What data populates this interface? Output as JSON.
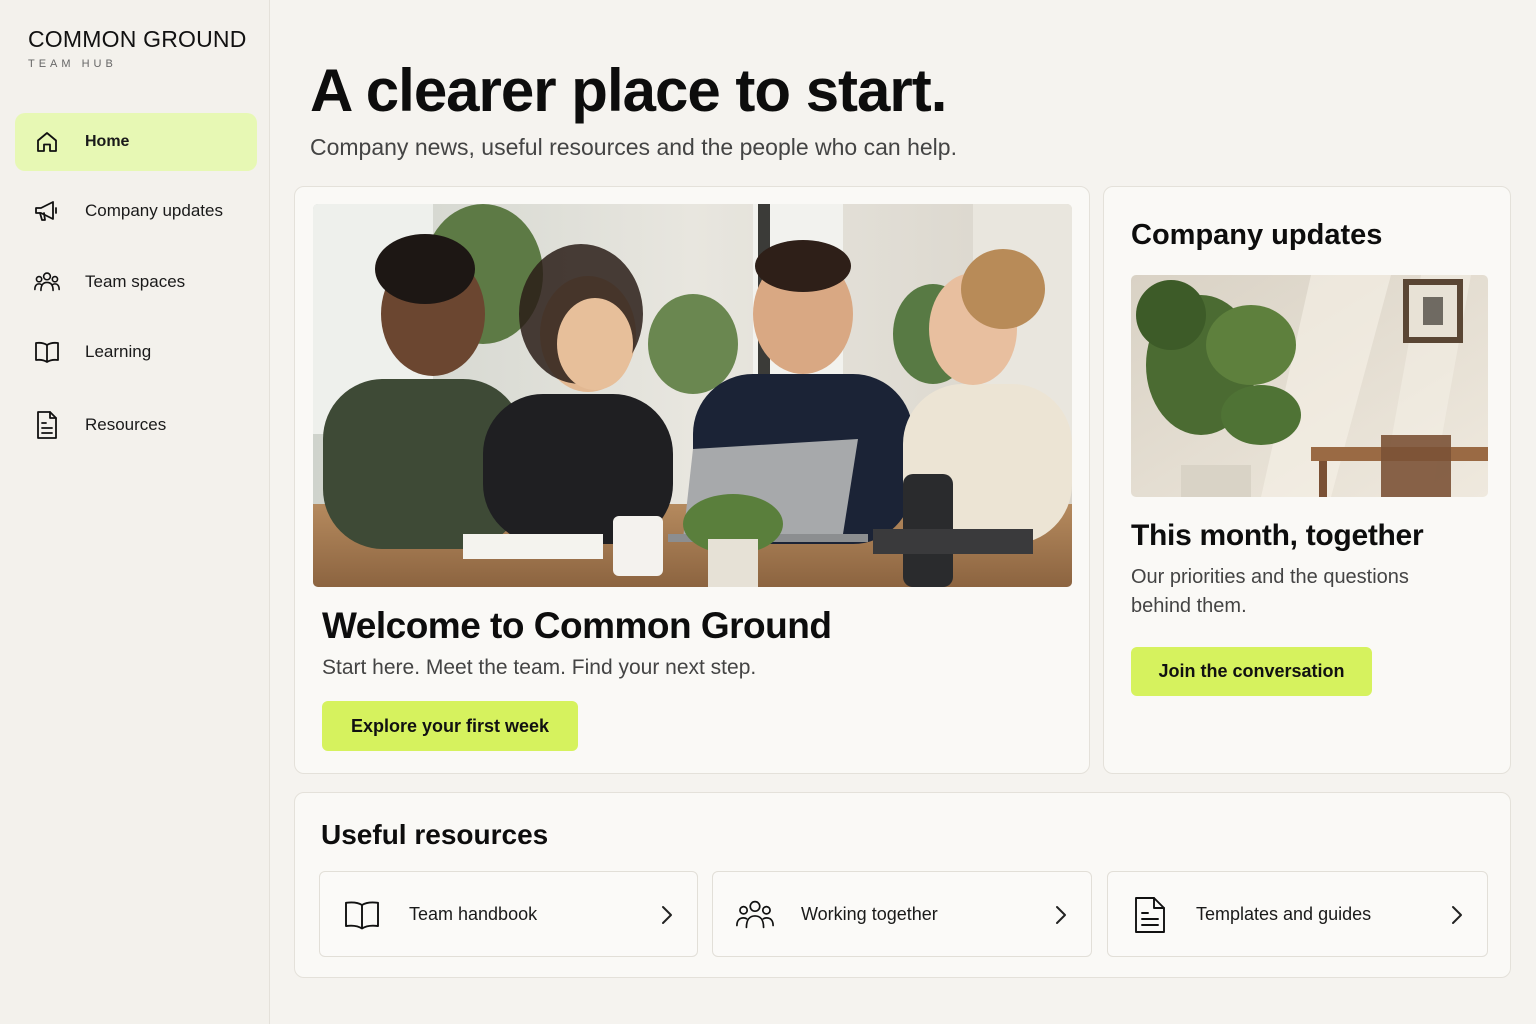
{
  "brand": {
    "name": "COMMON GROUND",
    "subtitle": "TEAM HUB"
  },
  "sidebar": {
    "items": [
      {
        "label": "Home",
        "icon": "home-icon",
        "active": true
      },
      {
        "label": "Company updates",
        "icon": "megaphone-icon",
        "active": false
      },
      {
        "label": "Team spaces",
        "icon": "people-icon",
        "active": false
      },
      {
        "label": "Learning",
        "icon": "book-icon",
        "active": false
      },
      {
        "label": "Resources",
        "icon": "document-icon",
        "active": false
      }
    ]
  },
  "header": {
    "title": "A clearer place to start.",
    "subtitle": "Company news, useful resources and the people who can help."
  },
  "hero": {
    "title": "Welcome to Common Ground",
    "subtitle": "Start here. Meet the team. Find your next step.",
    "button_label": "Explore your first week"
  },
  "updates": {
    "title": "Company updates",
    "headline": "This month, together",
    "description": "Our priorities and the questions behind them.",
    "button_label": "Join the conversation"
  },
  "resources": {
    "title": "Useful resources",
    "items": [
      {
        "label": "Team handbook",
        "icon": "book-icon"
      },
      {
        "label": "Working together",
        "icon": "people-icon"
      },
      {
        "label": "Templates and guides",
        "icon": "document-icon"
      }
    ]
  },
  "colors": {
    "accent": "#d6f25e",
    "active_nav": "#e7f8b4",
    "background": "#f5f3ef"
  }
}
